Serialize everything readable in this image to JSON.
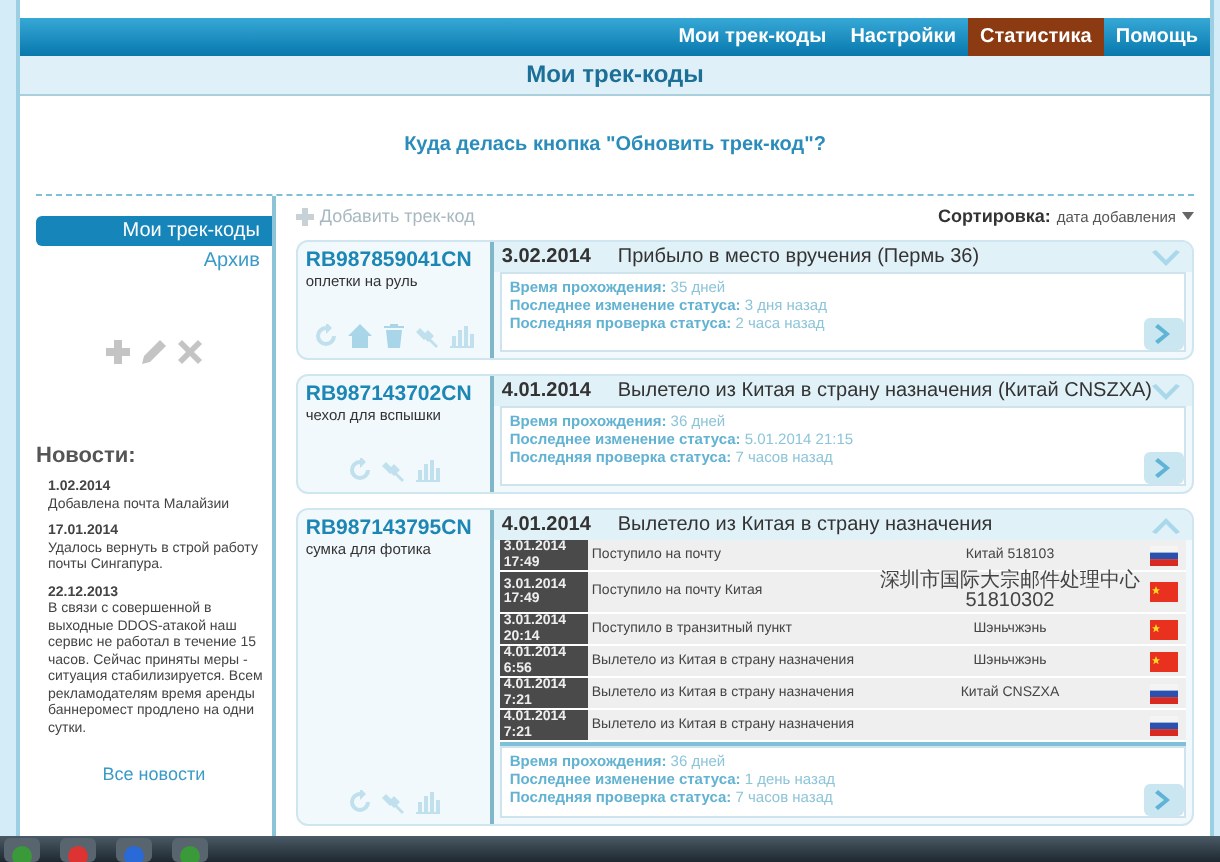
{
  "nav": {
    "tabs": [
      {
        "label": "Мои трек-коды",
        "selected": false
      },
      {
        "label": "Настройки",
        "selected": false
      },
      {
        "label": "Статистика",
        "selected": true
      },
      {
        "label": "Помощь",
        "selected": false
      }
    ]
  },
  "page_title": "Мои трек-коды",
  "notice": "Куда делась кнопка \"Обновить трек-код\"?",
  "sidebar": {
    "items": [
      {
        "label": "Мои трек-коды",
        "selected": true
      },
      {
        "label": "Архив",
        "selected": false
      }
    ],
    "news_title": "Новости:",
    "news": [
      {
        "date": "1.02.2014",
        "text": "Добавлена почта Малайзии"
      },
      {
        "date": "17.01.2014",
        "text": "Удалось вернуть в строй работу почты Сингапура."
      },
      {
        "date": "22.12.2013",
        "text": "В связи с совершенной в выходные DDOS-атакой наш сервис не работал в течение 15 часов. Сейчас приняты меры - ситуация стабилизируется. Всем рекламодателям время аренды баннеромест продлено на одни сутки."
      }
    ],
    "all_news": "Все новости"
  },
  "toolbar": {
    "add": "Добавить трек-код",
    "sort_label": "Сортировка:",
    "sort_value": "дата добавления"
  },
  "parcels": [
    {
      "code": "RB987859041CN",
      "description": "оплетки на руль",
      "actions": [
        {
          "kind": "refresh"
        },
        {
          "kind": "house"
        },
        {
          "kind": "bin"
        },
        {
          "kind": "satellite"
        },
        {
          "kind": "chart"
        }
      ],
      "date": "3.02.2014",
      "status": "Прибыло в место вручения (Пермь 36)",
      "expanded": false,
      "details": [
        {
          "label": "Время прохождения:",
          "value": "35 дней"
        },
        {
          "label": "Последнее изменение статуса:",
          "value": "3 дня назад"
        },
        {
          "label": "Последняя проверка статуса:",
          "value": "2 часа назад"
        }
      ]
    },
    {
      "code": "RB987143702CN",
      "description": "чехол для вспышки",
      "actions": [
        {
          "kind": "refresh"
        },
        {
          "kind": "satellite"
        },
        {
          "kind": "chart"
        }
      ],
      "date": "4.01.2014",
      "status": "Вылетело из Китая в страну назначения (Китай CNSZXA)",
      "expanded": false,
      "details": [
        {
          "label": "Время прохождения:",
          "value": "36 дней"
        },
        {
          "label": "Последнее изменение статуса:",
          "value": "5.01.2014 21:15"
        },
        {
          "label": "Последняя проверка статуса:",
          "value": "7 часов назад"
        }
      ]
    },
    {
      "code": "RB987143795CN",
      "description": "сумка для фотика",
      "actions": [
        {
          "kind": "refresh"
        },
        {
          "kind": "satellite"
        },
        {
          "kind": "chart"
        }
      ],
      "date": "4.01.2014",
      "status": "Вылетело из Китая в страну назначения",
      "expanded": true,
      "events": [
        {
          "date": "3.01.2014",
          "time": "17:49",
          "status": "Поступило на почту",
          "place": "Китай 518103",
          "kind": "russia"
        },
        {
          "date": "3.01.2014",
          "time": "17:49",
          "status": "Поступило на почту Китая",
          "place": "深圳市国际大宗邮件处理中心 51810302",
          "kind": "china"
        },
        {
          "date": "3.01.2014",
          "time": "20:14",
          "status": "Поступило в транзитный пункт",
          "place": "Шэньчжэнь",
          "kind": "china"
        },
        {
          "date": "4.01.2014",
          "time": "6:56",
          "status": "Вылетело из Китая в страну назначения",
          "place": "Шэньчжэнь",
          "kind": "china"
        },
        {
          "date": "4.01.2014",
          "time": "7:21",
          "status": "Вылетело из Китая в страну назначения",
          "place": "Китай CNSZXA",
          "kind": "russia"
        },
        {
          "date": "4.01.2014",
          "time": "7:21",
          "status": "Вылетело из Китая в страну назначения",
          "kind": "russia"
        }
      ],
      "details": [
        {
          "label": "Время прохождения:",
          "value": "36 дней"
        },
        {
          "label": "Последнее изменение статуса:",
          "value": "1 день назад"
        },
        {
          "label": "Последняя проверка статуса:",
          "value": "7 часов назад"
        }
      ]
    }
  ]
}
